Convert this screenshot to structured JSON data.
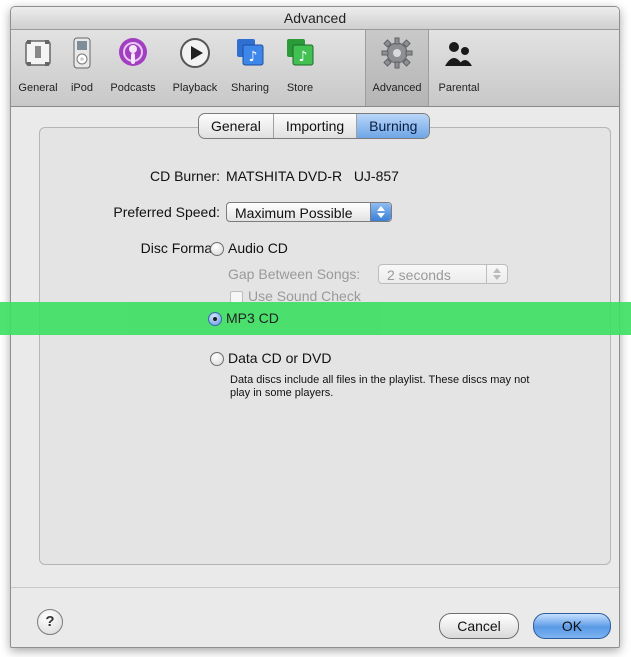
{
  "window": {
    "title": "Advanced"
  },
  "toolbar": {
    "items": [
      {
        "label": "General",
        "icon": "general-switch-icon"
      },
      {
        "label": "iPod",
        "icon": "ipod-icon"
      },
      {
        "label": "Podcasts",
        "icon": "podcasts-icon"
      },
      {
        "label": "Playback",
        "icon": "playback-icon"
      },
      {
        "label": "Sharing",
        "icon": "sharing-icon"
      },
      {
        "label": "Store",
        "icon": "store-icon"
      },
      {
        "label": "Advanced",
        "icon": "gear-icon",
        "selected": true
      },
      {
        "label": "Parental",
        "icon": "parental-icon"
      }
    ]
  },
  "tabs": [
    {
      "label": "General"
    },
    {
      "label": "Importing"
    },
    {
      "label": "Burning",
      "active": true
    }
  ],
  "burning": {
    "cd_burner_label": "CD Burner:",
    "cd_burner_value": "MATSHITA DVD-R   UJ-857",
    "preferred_speed_label": "Preferred Speed:",
    "preferred_speed_value": "Maximum Possible",
    "disc_format_label": "Disc Format:",
    "audio_cd_label": "Audio CD",
    "gap_label": "Gap Between Songs:",
    "gap_value": "2 seconds",
    "sound_check_label": "Use Sound Check",
    "mp3_cd_label": "MP3 CD",
    "data_cd_label": "Data CD or DVD",
    "data_note": "Data discs include all files in the playlist. These discs may not play in some players.",
    "selected_format": "MP3 CD"
  },
  "footer": {
    "help_label": "?",
    "cancel_label": "Cancel",
    "ok_label": "OK"
  },
  "colors": {
    "highlight": "#3fe065",
    "accent_blue": "#5a9ae6"
  }
}
